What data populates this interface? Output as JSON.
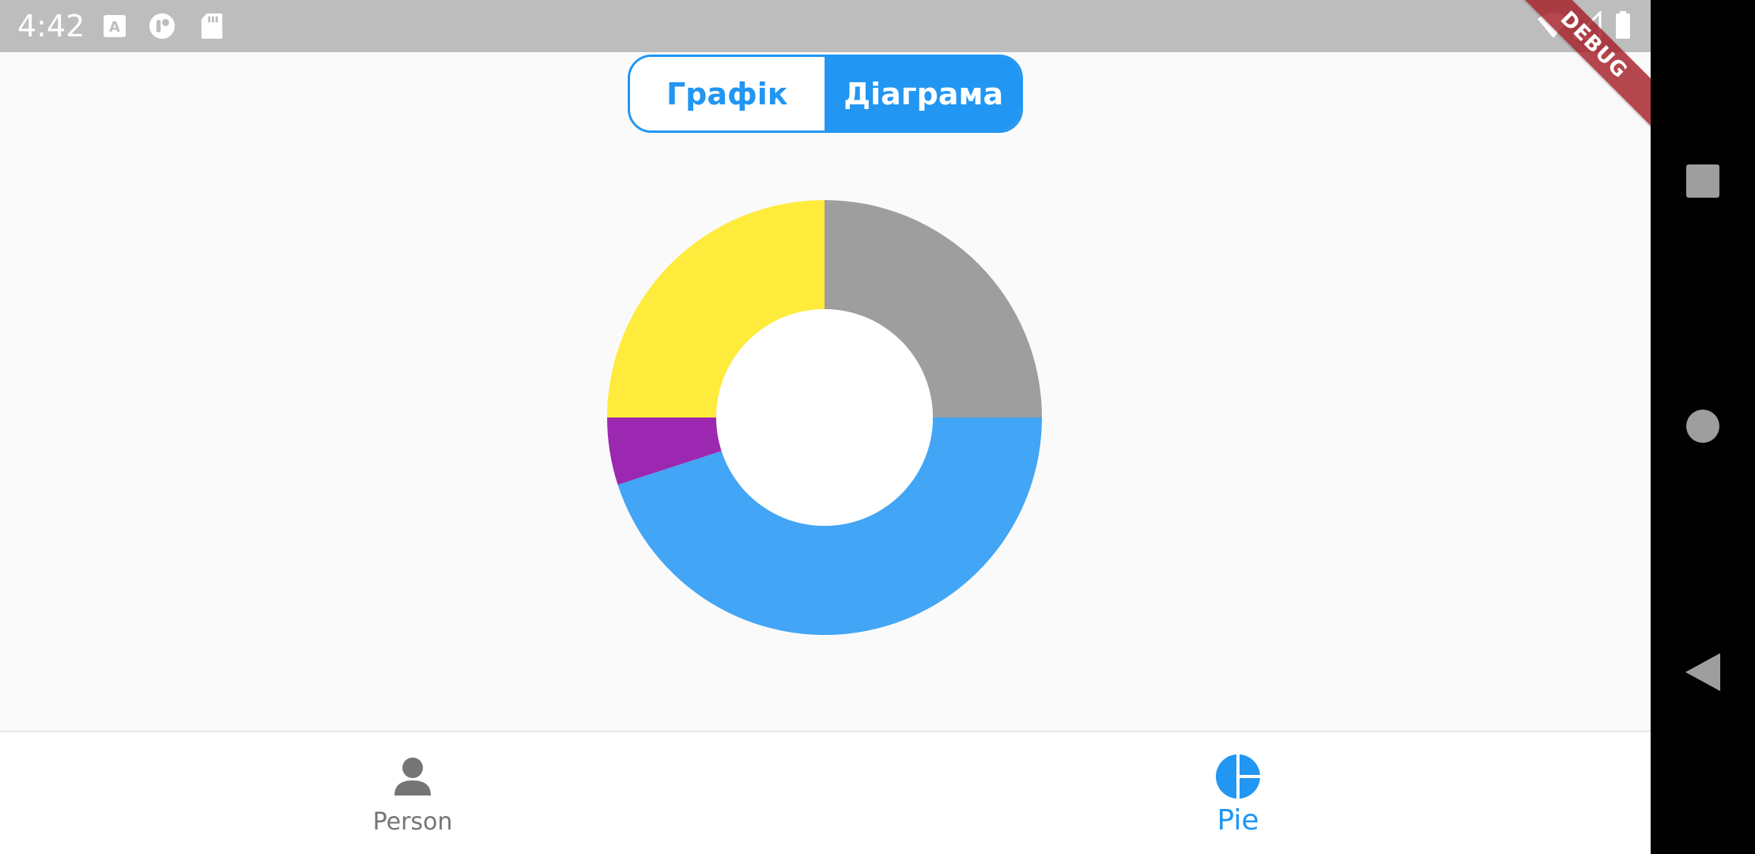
{
  "status_bar": {
    "time": "4:42",
    "icons": [
      "text-a-icon",
      "notification-dot-icon",
      "sd-card-icon",
      "wifi-icon",
      "cell-signal-icon",
      "battery-icon"
    ],
    "debug_label": "DEBUG"
  },
  "segmented_control": {
    "options": [
      "Графік",
      "Діаграма"
    ],
    "selected": "Діаграма"
  },
  "chart_data": {
    "type": "pie",
    "donut": true,
    "slices": [
      {
        "value": 25,
        "color": "#9e9e9e"
      },
      {
        "value": 45,
        "color": "#42a5f5"
      },
      {
        "value": 5,
        "color": "#9c27b0"
      },
      {
        "value": 25,
        "color": "#ffeb3b"
      }
    ]
  },
  "bottom_nav": {
    "items": [
      {
        "label": "Person",
        "icon": "person-icon",
        "active": false
      },
      {
        "label": "Pie",
        "icon": "pie-chart-icon",
        "active": true
      }
    ],
    "active_color": "#2196f3",
    "inactive_color": "#757575"
  },
  "system_nav": {
    "buttons": [
      "recents-square-icon",
      "home-circle-icon",
      "back-triangle-icon"
    ]
  }
}
